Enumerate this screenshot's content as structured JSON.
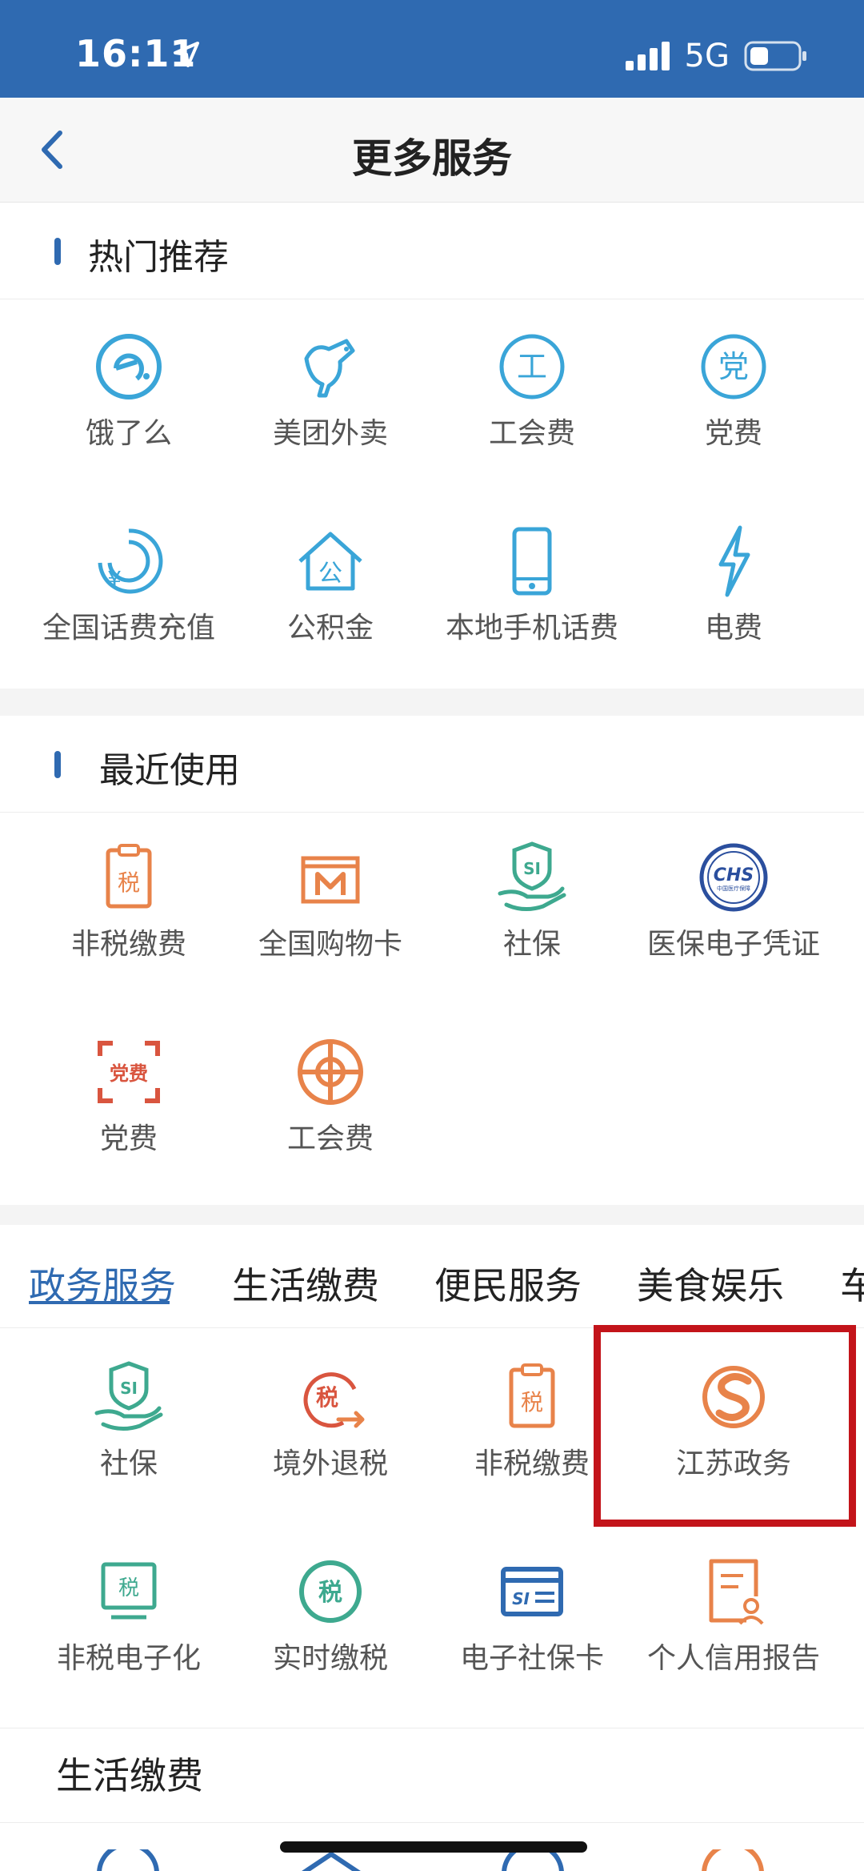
{
  "status": {
    "time": "16:11",
    "network": "5G"
  },
  "header": {
    "title": "更多服务"
  },
  "hot": {
    "title": "热门推荐",
    "items": [
      {
        "label": "饿了么",
        "icon": "eleme-icon"
      },
      {
        "label": "美团外卖",
        "icon": "kangaroo-icon"
      },
      {
        "label": "工会费",
        "icon": "union-icon"
      },
      {
        "label": "党费",
        "icon": "party-icon"
      },
      {
        "label": "全国话费充值",
        "icon": "yuan-recharge-icon"
      },
      {
        "label": "公积金",
        "icon": "house-fund-icon"
      },
      {
        "label": "本地手机话费",
        "icon": "phone-icon"
      },
      {
        "label": "电费",
        "icon": "lightning-icon"
      }
    ],
    "icon_glyphs": {
      "union": "工",
      "party": "党",
      "fund": "公",
      "yuan": "¥"
    }
  },
  "recent": {
    "title": "最近使用",
    "items": [
      {
        "label": "非税缴费",
        "icon": "tax-clipboard-icon"
      },
      {
        "label": "全国购物卡",
        "icon": "shopping-card-icon"
      },
      {
        "label": "社保",
        "icon": "social-security-icon"
      },
      {
        "label": "医保电子凭证",
        "icon": "chs-icon"
      },
      {
        "label": "党费",
        "icon": "party-fee-icon"
      },
      {
        "label": "工会费",
        "icon": "union-fee-icon"
      }
    ],
    "icon_glyphs": {
      "tax": "税",
      "chs": "CHS",
      "chs_sub": "中国医疗保障",
      "party_fee": "党费",
      "si": "SI"
    }
  },
  "tabs": [
    "政务服务",
    "生活缴费",
    "便民服务",
    "美食娱乐",
    "车"
  ],
  "gov": {
    "items": [
      {
        "label": "社保",
        "icon": "social-security-icon"
      },
      {
        "label": "境外退税",
        "icon": "tax-refund-icon"
      },
      {
        "label": "非税缴费",
        "icon": "tax-clipboard-icon"
      },
      {
        "label": "江苏政务",
        "icon": "jiangsu-gov-icon"
      },
      {
        "label": "非税电子化",
        "icon": "tax-monitor-icon"
      },
      {
        "label": "实时缴税",
        "icon": "realtime-tax-icon"
      },
      {
        "label": "电子社保卡",
        "icon": "si-card-icon"
      },
      {
        "label": "个人信用报告",
        "icon": "credit-report-icon"
      }
    ]
  },
  "life": {
    "title": "生活缴费"
  },
  "colors": {
    "primary": "#2f6ab1",
    "cyan": "#3aa5d8",
    "orange": "#e8834a",
    "red": "#d9553f",
    "green": "#3ea98f",
    "highlight": "#c3141a"
  }
}
